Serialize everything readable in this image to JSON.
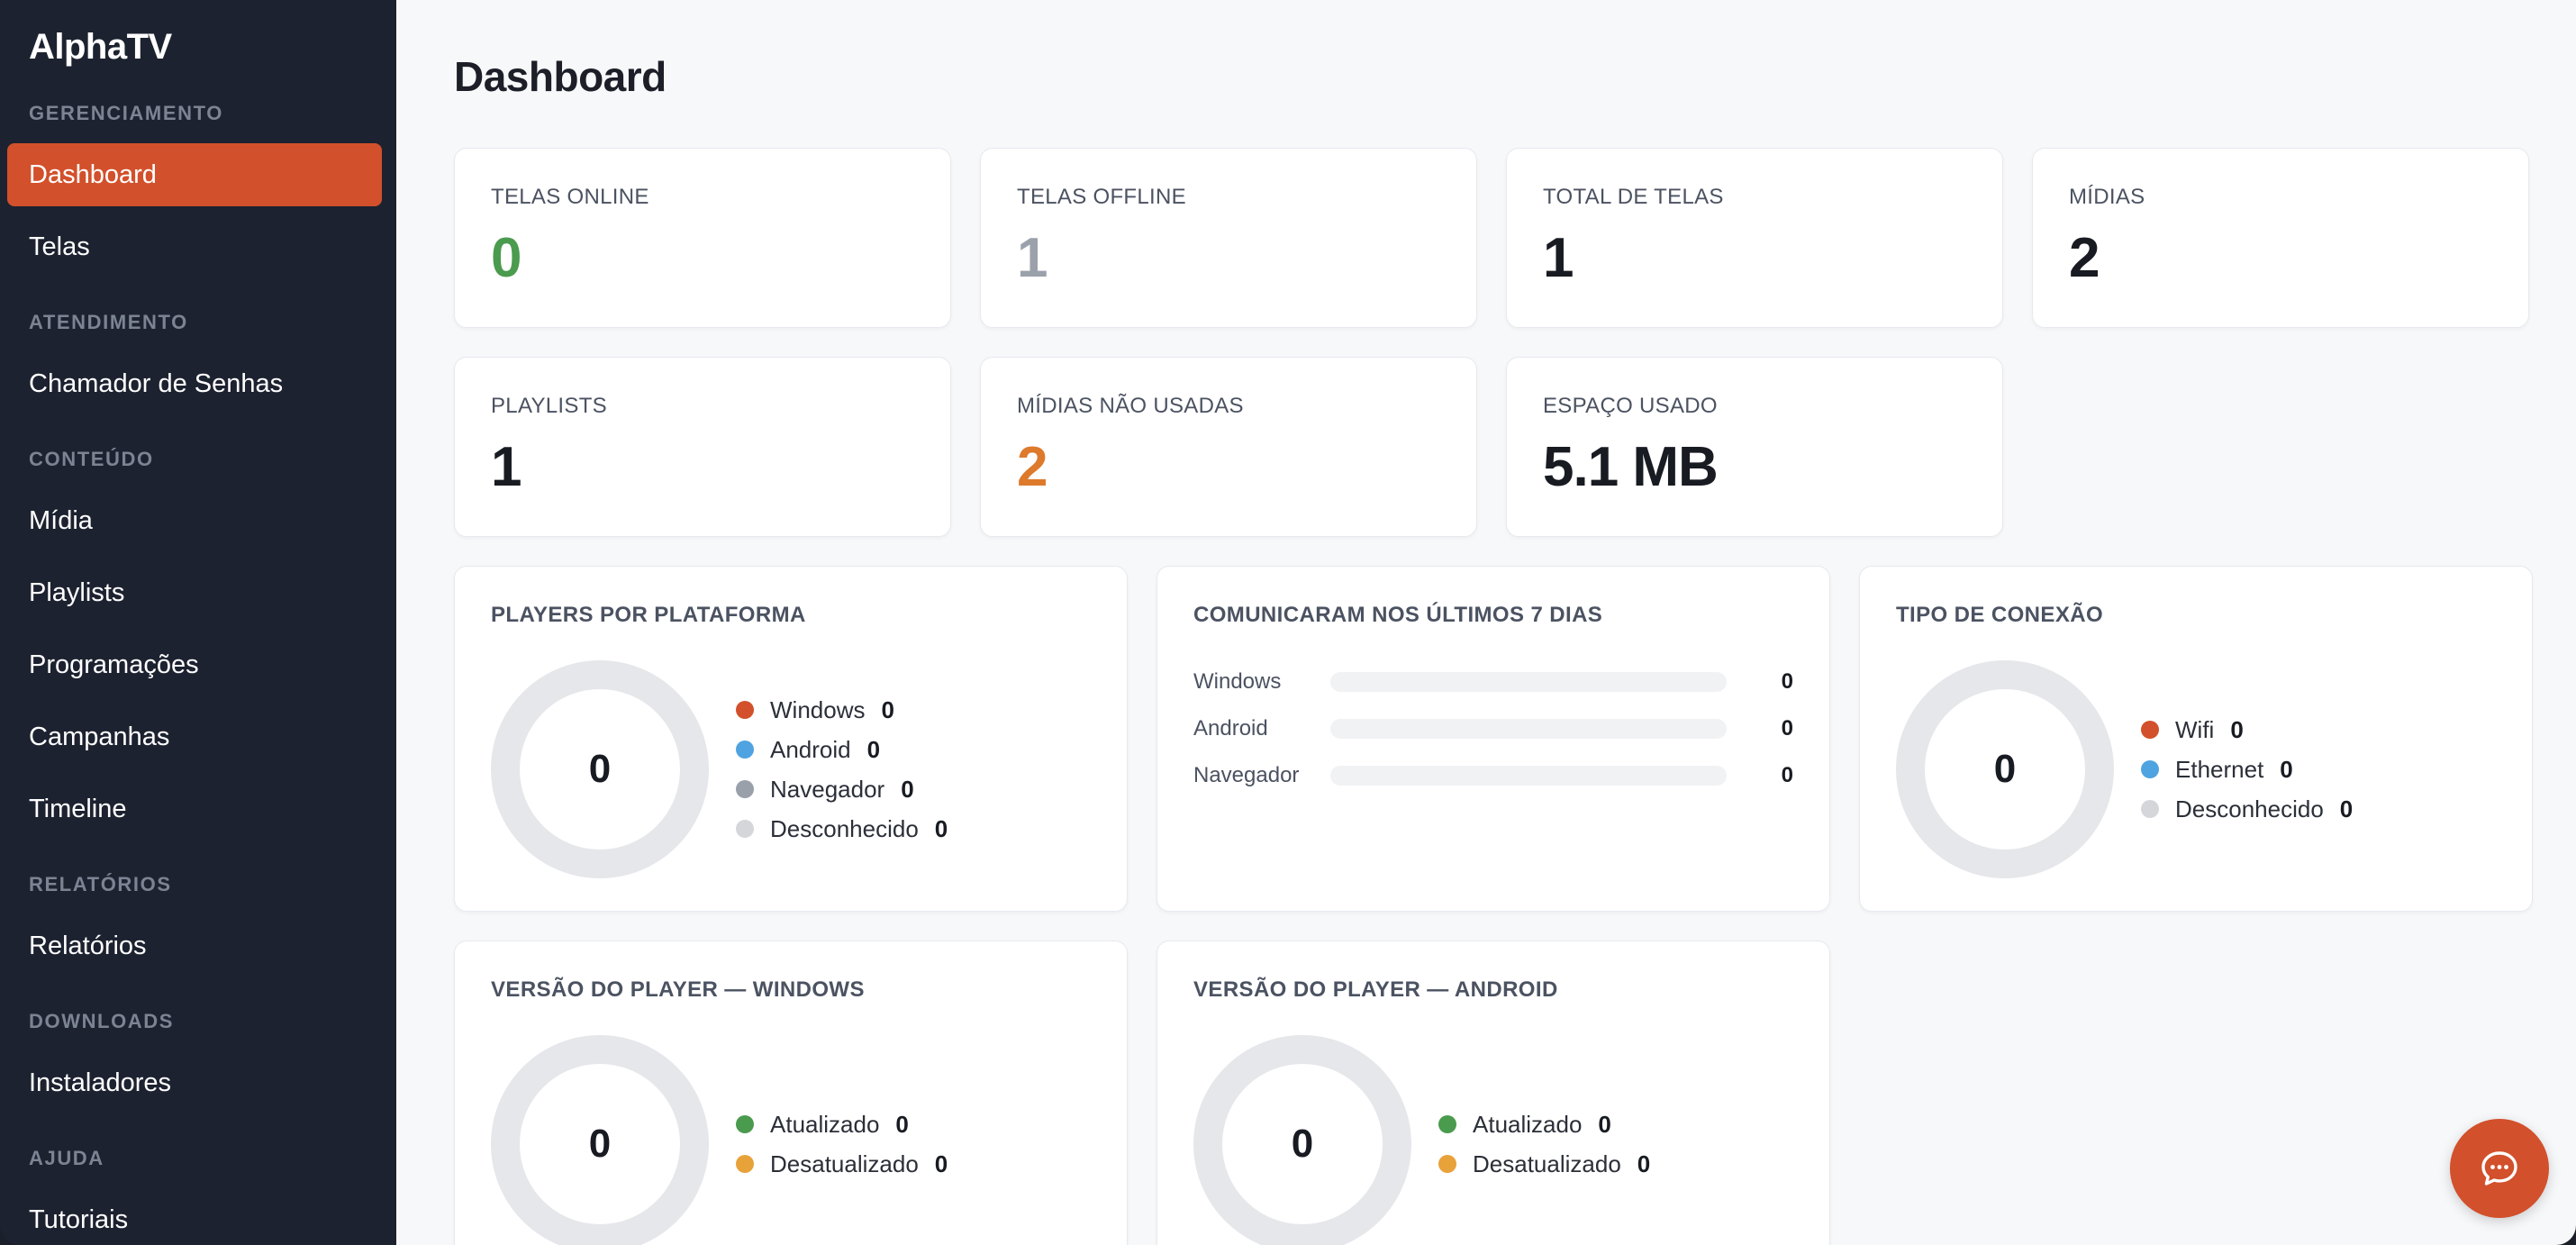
{
  "sidebar": {
    "brand": "AlphaTV",
    "sections": {
      "gerenciamento": "GERENCIAMENTO",
      "atendimento": "ATENDIMENTO",
      "conteudo": "CONTEÚDO",
      "relatorios": "RELATÓRIOS",
      "downloads": "DOWNLOADS",
      "ajuda": "AJUDA"
    },
    "items": {
      "dashboard": "Dashboard",
      "telas": "Telas",
      "chamador": "Chamador de Senhas",
      "midia": "Mídia",
      "playlists": "Playlists",
      "programacoes": "Programações",
      "campanhas": "Campanhas",
      "timeline": "Timeline",
      "relatorios": "Relatórios",
      "instaladores": "Instaladores",
      "tutoriais": "Tutoriais"
    },
    "active_item": "Dashboard",
    "accent_color": "#d2502b"
  },
  "main": {
    "title": "Dashboard",
    "stats": [
      {
        "label": "TELAS ONLINE",
        "value": "0",
        "color": "#4b9b4f"
      },
      {
        "label": "TELAS OFFLINE",
        "value": "1",
        "color": "#9ba1ab"
      },
      {
        "label": "TOTAL DE TELAS",
        "value": "1"
      },
      {
        "label": "MÍDIAS",
        "value": "2"
      },
      {
        "label": "PLAYLISTS",
        "value": "1"
      },
      {
        "label": "MÍDIAS NÃO USADAS",
        "value": "2",
        "color": "#dd7a2c"
      },
      {
        "label": "ESPAÇO USADO",
        "value": "5.1 MB"
      }
    ],
    "platform_panel": {
      "title": "PLAYERS POR PLATAFORMA",
      "total": "0",
      "legend": [
        {
          "label": "Windows",
          "count": "0",
          "color": "#d2502b"
        },
        {
          "label": "Android",
          "count": "0",
          "color": "#4fa3e0"
        },
        {
          "label": "Navegador",
          "count": "0",
          "color": "#9aa0aa"
        },
        {
          "label": "Desconhecido",
          "count": "0",
          "color": "#d4d6da"
        }
      ]
    },
    "recent_panel": {
      "title": "COMUNICARAM NOS ÚLTIMOS 7 DIAS",
      "rows": [
        {
          "label": "Windows",
          "count": "0",
          "fraction": 0
        },
        {
          "label": "Android",
          "count": "0",
          "fraction": 0
        },
        {
          "label": "Navegador",
          "count": "0",
          "fraction": 0
        }
      ]
    },
    "connection_panel": {
      "title": "TIPO DE CONEXÃO",
      "total": "0",
      "legend": [
        {
          "label": "Wifi",
          "count": "0",
          "color": "#d2502b"
        },
        {
          "label": "Ethernet",
          "count": "0",
          "color": "#4fa3e0"
        },
        {
          "label": "Desconhecido",
          "count": "0",
          "color": "#d4d6da"
        }
      ]
    },
    "windows_version_panel": {
      "title": "VERSÃO DO PLAYER — WINDOWS",
      "total": "0",
      "legend": [
        {
          "label": "Atualizado",
          "count": "0",
          "color": "#4b9b4f"
        },
        {
          "label": "Desatualizado",
          "count": "0",
          "color": "#e8a23a"
        }
      ]
    },
    "android_version_panel": {
      "title": "VERSÃO DO PLAYER — ANDROID",
      "total": "0",
      "legend": [
        {
          "label": "Atualizado",
          "count": "0",
          "color": "#4b9b4f"
        },
        {
          "label": "Desatualizado",
          "count": "0",
          "color": "#e8a23a"
        }
      ]
    },
    "chat_button_icon": "chat-bubble-icon"
  }
}
